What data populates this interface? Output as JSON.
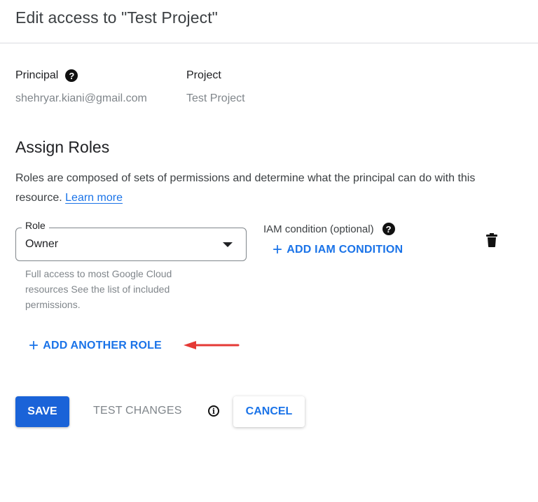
{
  "dialog": {
    "title": "Edit access to \"Test Project\""
  },
  "principal": {
    "label": "Principal",
    "value": "shehryar.kiani@gmail.com",
    "help_icon": "help-circle-icon"
  },
  "project": {
    "label": "Project",
    "value": "Test Project"
  },
  "assign_roles": {
    "heading": "Assign Roles",
    "description": "Roles are composed of sets of permissions and determine what the principal can do with this resource.",
    "learn_more": "Learn more"
  },
  "role": {
    "label": "Role",
    "selected": "Owner",
    "hint": "Full access to most Google Cloud resources See the list of included permissions."
  },
  "iam_condition": {
    "label": "IAM condition (optional)",
    "help_icon": "help-circle-icon",
    "add_label": "ADD IAM CONDITION"
  },
  "delete_icon": "trash-icon",
  "add_role": {
    "label": "ADD ANOTHER ROLE"
  },
  "annotation": {
    "arrow_color": "#e53935"
  },
  "actions": {
    "save": "SAVE",
    "test_changes": "TEST CHANGES",
    "info_icon": "info-icon",
    "cancel": "CANCEL"
  },
  "colors": {
    "primary": "#1a73e8",
    "save_bg": "#1a63d8"
  }
}
